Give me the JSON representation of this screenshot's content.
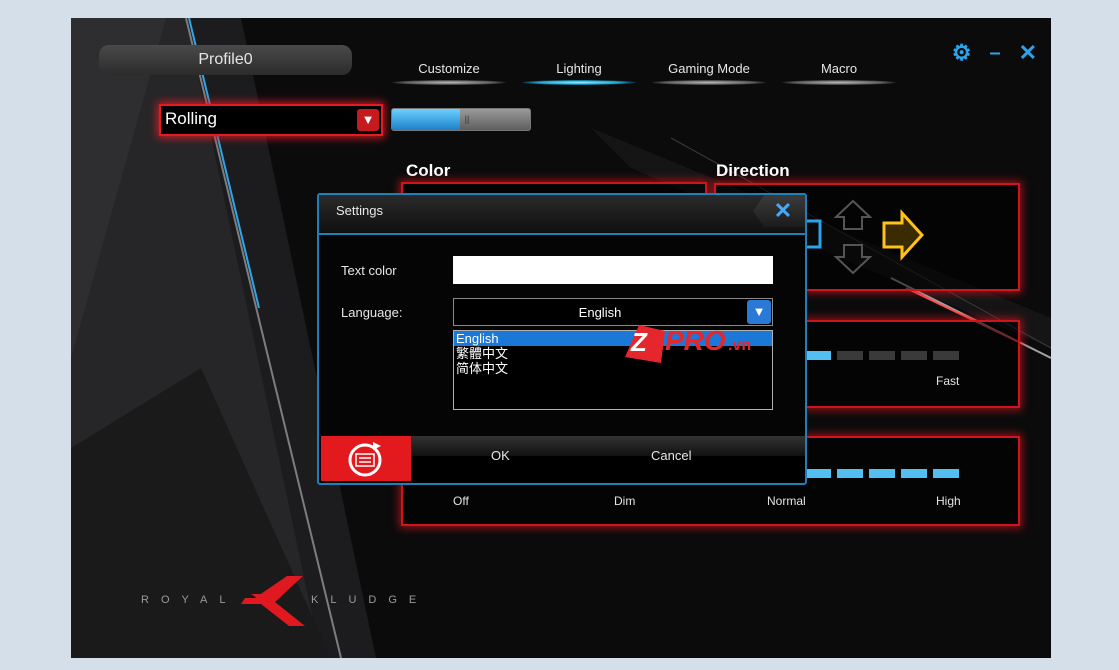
{
  "header": {
    "profile_name": "Profile0",
    "tabs": [
      {
        "label": "Customize"
      },
      {
        "label": "Lighting"
      },
      {
        "label": "Gaming Mode"
      },
      {
        "label": "Macro"
      }
    ],
    "active_tab": "Lighting"
  },
  "lighting": {
    "effect_value": "Rolling",
    "toggle_state": "on",
    "color_heading": "Color",
    "direction_heading": "Direction",
    "speed_label_fast": "Fast",
    "brightness_labels": [
      "Off",
      "Dim",
      "Normal",
      "High"
    ]
  },
  "settings_dialog": {
    "title": "Settings",
    "text_color_label": "Text color",
    "language_label": "Language:",
    "language_value": "English",
    "language_options": [
      "English",
      "繁體中文",
      "简体中文"
    ],
    "ok_label": "OK",
    "cancel_label": "Cancel"
  },
  "watermark": {
    "text_z": "Z",
    "text_pro": "PRO",
    "text_vn": ".vn"
  },
  "brand": {
    "left": "ROYAL",
    "right": "KLUDGE"
  },
  "colors": {
    "accent_red": "#e21b24",
    "accent_blue": "#2aa4ea",
    "selection_blue": "#1b78d6"
  }
}
